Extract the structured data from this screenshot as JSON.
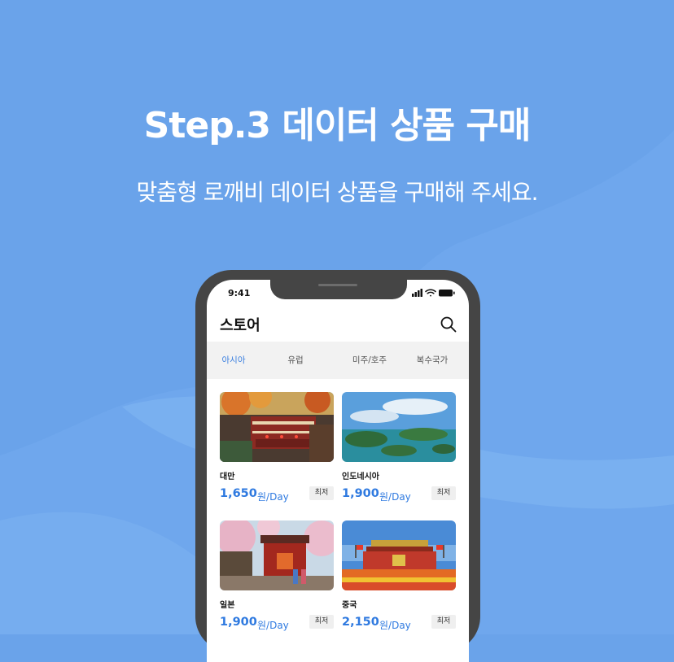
{
  "banner": {
    "title": "Step.3 데이터 상품 구매",
    "subtitle": "맞춤형 로깨비 데이터 상품을 구매해 주세요."
  },
  "phone": {
    "status_time": "9:41",
    "status_icons": [
      "signal-icon",
      "wifi-icon",
      "battery-icon"
    ],
    "app_title": "스토어",
    "search_icon": "search-icon",
    "tabs": [
      {
        "label": "아시아",
        "active": true
      },
      {
        "label": "유럽",
        "active": false
      },
      {
        "label": "미주/호주",
        "active": false
      },
      {
        "label": "복수국가",
        "active": false
      }
    ],
    "products": [
      {
        "name": "대만",
        "price": "1,650",
        "unit": "원/Day",
        "badge": "최저"
      },
      {
        "name": "인도네시아",
        "price": "1,900",
        "unit": "원/Day",
        "badge": "최저"
      },
      {
        "name": "일본",
        "price": "1,900",
        "unit": "원/Day",
        "badge": "최저"
      },
      {
        "name": "중국",
        "price": "2,150",
        "unit": "원/Day",
        "badge": "최저"
      }
    ]
  },
  "colors": {
    "background": "#6aa3ea",
    "accent": "#2f7ae0",
    "phone_frame": "#454545"
  }
}
